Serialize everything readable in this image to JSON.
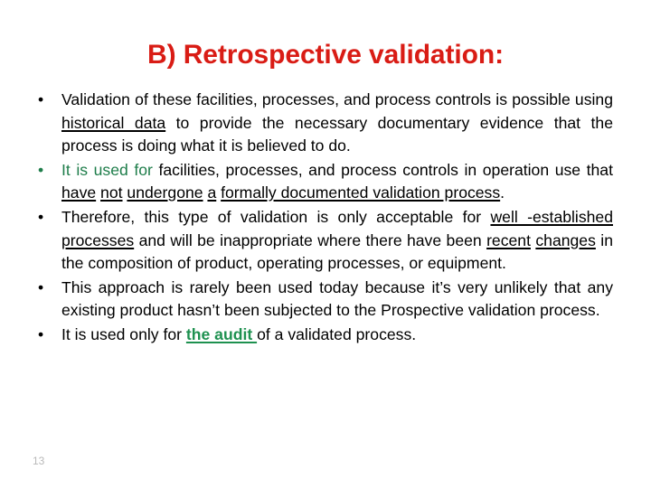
{
  "slide": {
    "title": "B) Retrospective validation:",
    "title_color": "#d91c15",
    "accent_green": "#1e7d4a",
    "body_color": "#000000",
    "background": "#ffffff",
    "page_number": "13",
    "bullet_glyph": "•",
    "bullets": [
      {
        "marker_color": "#000000",
        "segments": [
          {
            "text": "Validation of these facilities, processes, and process controls is possible using ",
            "style": "plain"
          },
          {
            "text": "historical data",
            "style": "underline"
          },
          {
            "text": " to provide the necessary documentary evidence that the process is doing what it is believed to do.",
            "style": "plain"
          }
        ],
        "plain_text": "Validation of these facilities, processes, and process controls is possible using historical data to provide the necessary documentary evidence that the process is doing what it is believed to do."
      },
      {
        "marker_color": "#1e7d4a",
        "segments": [
          {
            "text": "It is used for",
            "style": "green"
          },
          {
            "text": " facilities, processes, and process controls in operation use that ",
            "style": "plain"
          },
          {
            "text": "have",
            "style": "underline"
          },
          {
            "text": " ",
            "style": "plain"
          },
          {
            "text": "not",
            "style": "underline"
          },
          {
            "text": " ",
            "style": "plain"
          },
          {
            "text": "undergone",
            "style": "underline"
          },
          {
            "text": " ",
            "style": "plain"
          },
          {
            "text": "a",
            "style": "underline"
          },
          {
            "text": " ",
            "style": "plain"
          },
          {
            "text": "formally documented validation process",
            "style": "underline"
          },
          {
            "text": ".",
            "style": "plain"
          }
        ],
        "plain_text": "It is used for facilities, processes, and process controls in operation use that have not undergone a formally documented validation process."
      },
      {
        "marker_color": "#000000",
        "segments": [
          {
            "text": "Therefore, this type of validation is only acceptable for ",
            "style": "plain"
          },
          {
            "text": "well -established",
            "style": "underline"
          },
          {
            "text": " ",
            "style": "plain"
          },
          {
            "text": "processes",
            "style": "underline"
          },
          {
            "text": " and will be inappropriate where there have been ",
            "style": "plain"
          },
          {
            "text": "recent",
            "style": "underline"
          },
          {
            "text": " ",
            "style": "plain"
          },
          {
            "text": "changes",
            "style": "underline"
          },
          {
            "text": " in the composition of product, operating processes, or equipment.",
            "style": "plain"
          }
        ],
        "plain_text": "Therefore, this type of validation is only acceptable for well -established processes and will be inappropriate where there have been recent changes in the composition of product, operating processes, or equipment."
      },
      {
        "marker_color": "#000000",
        "segments": [
          {
            "text": "This approach is rarely been used today because it’s very unlikely that any existing product hasn’t been subjected to the Prospective validation process.",
            "style": "plain"
          }
        ],
        "plain_text": "This approach is rarely been used today because it’s very unlikely that any existing product hasn’t been subjected to the Prospective validation process."
      },
      {
        "marker_color": "#000000",
        "segments": [
          {
            "text": "It is used only for ",
            "style": "plain"
          },
          {
            "text": "the audit ",
            "style": "green-strong"
          },
          {
            "text": "of a validated process.",
            "style": "plain"
          }
        ],
        "plain_text": "It is used only for the audit of a validated process."
      }
    ]
  }
}
